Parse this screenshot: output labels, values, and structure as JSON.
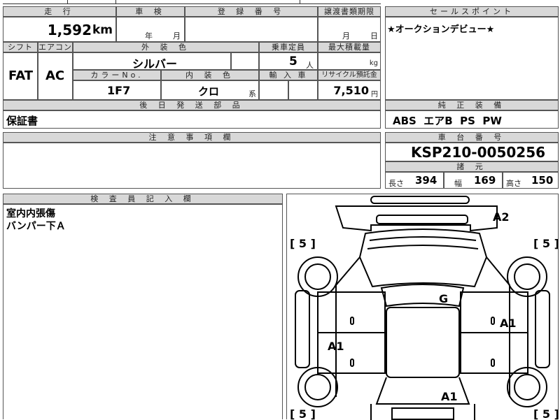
{
  "top_strip": {
    "fragment1": "",
    "fragment2": ""
  },
  "mileage": {
    "label": "走 行",
    "value": "1,592",
    "unit": "km"
  },
  "inspection": {
    "label": "車 検",
    "year_unit": "年",
    "month_unit": "月"
  },
  "registration": {
    "label": "登 録 番 号",
    "value": ""
  },
  "transfer_deadline": {
    "label": "譲渡書類期限",
    "month_unit": "月",
    "day_unit": "日"
  },
  "sales_point": {
    "label": "セールスポイント",
    "text": "★オークションデビュー★"
  },
  "shift": {
    "label": "シフト",
    "value": "FAT"
  },
  "aircon": {
    "label": "エアコン",
    "value": "AC"
  },
  "exterior_color": {
    "label": "外 装 色",
    "value": "シルバー"
  },
  "capacity": {
    "label": "乗車定員",
    "value": "5",
    "unit": "人"
  },
  "max_load": {
    "label": "最大積載量",
    "unit": "kg"
  },
  "color_no": {
    "label": "カラーNo.",
    "value": "1F7"
  },
  "interior_color": {
    "label": "内 装 色",
    "value": "クロ",
    "suffix": "系"
  },
  "import_car": {
    "label": "輸 入 車"
  },
  "recycle": {
    "label": "リサイクル預託金",
    "value": "7,510",
    "unit": "円"
  },
  "accessories": {
    "label": "後 日 発 送 部 品",
    "value": "保証書"
  },
  "standard_equipment": {
    "label": "純 正 装 備",
    "value": "ABS  エアB  PS  PW"
  },
  "notes": {
    "label": "注 意 事 項 欄"
  },
  "chassis": {
    "label": "車 台 番 号",
    "value": "KSP210-0050256"
  },
  "specs": {
    "label": "諸 元",
    "length_label": "長さ",
    "length": "394",
    "width_label": "幅",
    "width": "169",
    "height_label": "高さ",
    "height": "150"
  },
  "inspector": {
    "label": "検 査 員 記 入 欄",
    "line1": "室内内張傷",
    "line2": "バンパー下Ａ"
  },
  "diagram": {
    "tire_fl": "5",
    "tire_fr": "5",
    "tire_rl": "5",
    "tire_rr": "5",
    "mark_hood": "G",
    "mark_front_bumper": "A2",
    "mark_right_door": "A1",
    "mark_left_door": "A1",
    "mark_rear": "A1"
  }
}
